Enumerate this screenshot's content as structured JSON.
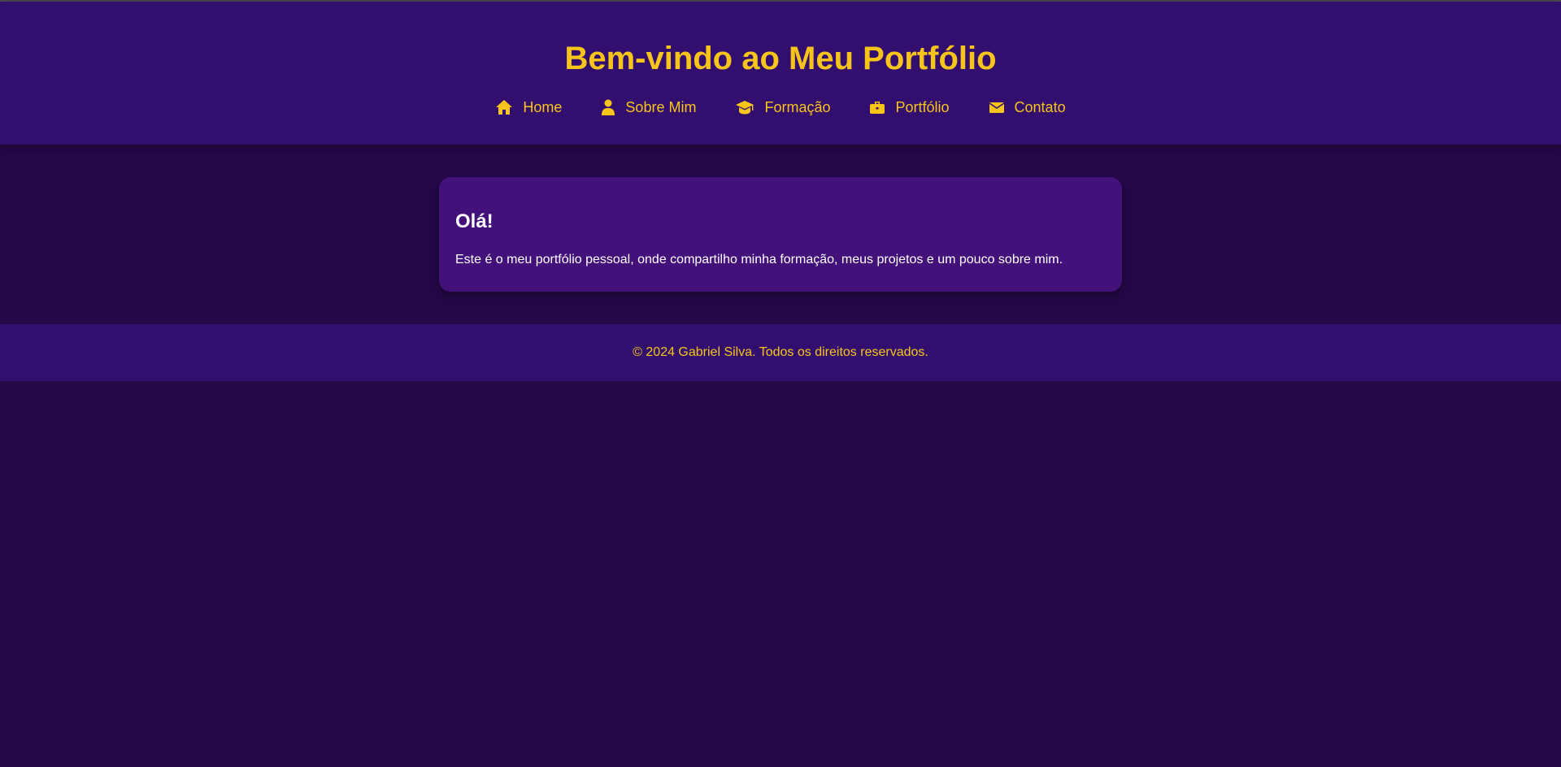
{
  "colors": {
    "accent": "#f7c51a",
    "header_bg": "#320e6e",
    "page_bg": "#240848",
    "card_bg": "#42127a",
    "text_light": "#ffffff"
  },
  "header": {
    "title": "Bem-vindo ao Meu Portfólio"
  },
  "nav": {
    "items": [
      {
        "label": "Home",
        "icon": "home-icon"
      },
      {
        "label": "Sobre Mim",
        "icon": "user-icon"
      },
      {
        "label": "Formação",
        "icon": "graduation-cap-icon"
      },
      {
        "label": "Portfólio",
        "icon": "briefcase-icon"
      },
      {
        "label": "Contato",
        "icon": "envelope-icon"
      }
    ]
  },
  "intro": {
    "heading": "Olá!",
    "text": "Este é o meu portfólio pessoal, onde compartilho minha formação, meus projetos e um pouco sobre mim."
  },
  "footer": {
    "copyright": "© 2024 Gabriel Silva. Todos os direitos reservados."
  }
}
